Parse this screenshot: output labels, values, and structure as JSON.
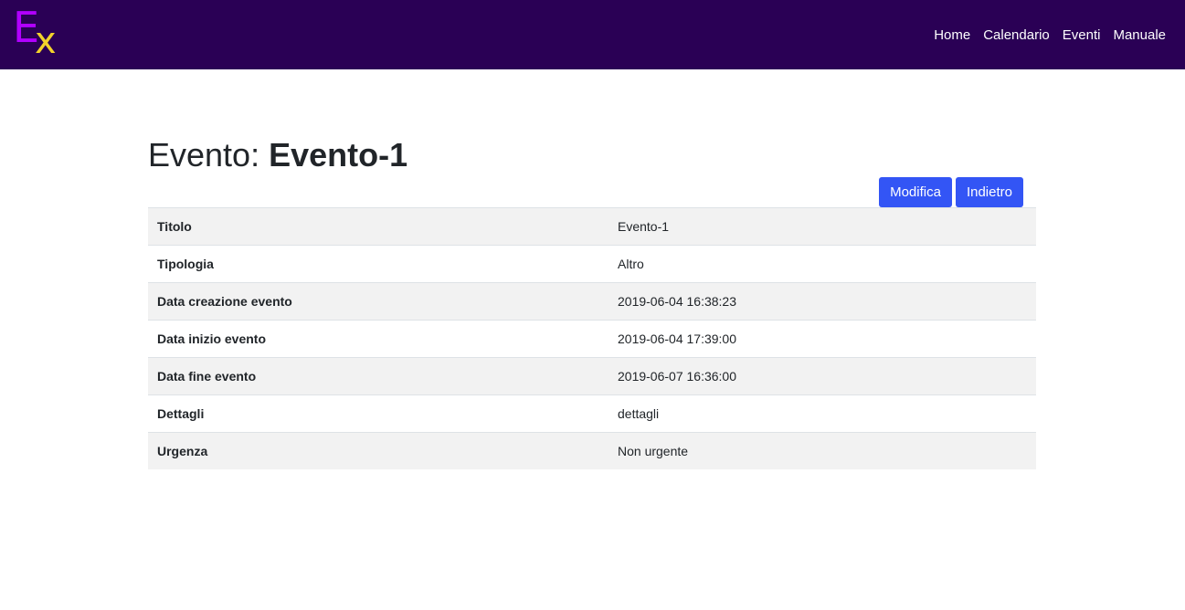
{
  "brand": {
    "letter_main": "E",
    "letter_sub": "x",
    "colors": {
      "main": "#b100ff",
      "sub": "#f2d22b",
      "navbar": "#2a0055"
    }
  },
  "nav": {
    "items": [
      {
        "label": "Home"
      },
      {
        "label": "Calendario"
      },
      {
        "label": "Eventi"
      },
      {
        "label": "Manuale"
      }
    ]
  },
  "page": {
    "title_prefix": "Evento:",
    "title_name": "Evento-1"
  },
  "actions": {
    "edit_label": "Modifica",
    "back_label": "Indietro",
    "button_color": "#3355f5"
  },
  "details": {
    "rows": [
      {
        "key": "Titolo",
        "value": "Evento-1"
      },
      {
        "key": "Tipologia",
        "value": "Altro"
      },
      {
        "key": "Data creazione evento",
        "value": "2019-06-04 16:38:23"
      },
      {
        "key": "Data inizio evento",
        "value": "2019-06-04 17:39:00"
      },
      {
        "key": "Data fine evento",
        "value": "2019-06-07 16:36:00"
      },
      {
        "key": "Dettagli",
        "value": "dettagli"
      },
      {
        "key": "Urgenza",
        "value": "Non urgente"
      }
    ]
  }
}
